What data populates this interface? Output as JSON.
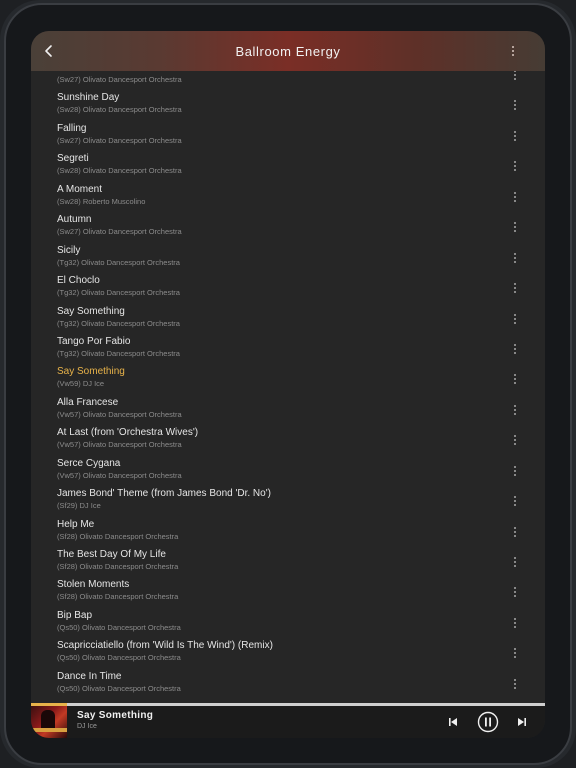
{
  "header": {
    "title": "Ballroom Energy"
  },
  "tracks": [
    {
      "title": "",
      "subtitle": "(Sw27) Olivato Dancesport Orchestra",
      "active": false
    },
    {
      "title": "Sunshine Day",
      "subtitle": "(Sw28) Olivato Dancesport Orchestra",
      "active": false
    },
    {
      "title": "Falling",
      "subtitle": "(Sw27) Olivato Dancesport Orchestra",
      "active": false
    },
    {
      "title": "Segreti",
      "subtitle": "(Sw28) Olivato Dancesport Orchestra",
      "active": false
    },
    {
      "title": "A Moment",
      "subtitle": "(Sw28) Roberto Muscolino",
      "active": false
    },
    {
      "title": "Autumn",
      "subtitle": "(Sw27) Olivato Dancesport Orchestra",
      "active": false
    },
    {
      "title": "Sicily",
      "subtitle": "(Tg32) Olivato Dancesport Orchestra",
      "active": false
    },
    {
      "title": "El Choclo",
      "subtitle": "(Tg32) Olivato Dancesport Orchestra",
      "active": false
    },
    {
      "title": "Say Something",
      "subtitle": "(Tg32) Olivato Dancesport Orchestra",
      "active": false
    },
    {
      "title": "Tango Por Fabio",
      "subtitle": "(Tg32) Olivato Dancesport Orchestra",
      "active": false
    },
    {
      "title": "Say Something",
      "subtitle": "(Vw59) DJ Ice",
      "active": true
    },
    {
      "title": "Alla Francese",
      "subtitle": "(Vw57) Olivato Dancesport Orchestra",
      "active": false
    },
    {
      "title": "At Last (from 'Orchestra Wives')",
      "subtitle": "(Vw57) Olivato Dancesport Orchestra",
      "active": false
    },
    {
      "title": "Serce Cygana",
      "subtitle": "(Vw57) Olivato Dancesport Orchestra",
      "active": false
    },
    {
      "title": "James Bond' Theme (from James Bond 'Dr. No')",
      "subtitle": "(Sf29) DJ Ice",
      "active": false
    },
    {
      "title": "Help Me",
      "subtitle": "(Sf28) Olivato Dancesport Orchestra",
      "active": false
    },
    {
      "title": "The Best Day Of My Life",
      "subtitle": "(Sf28) Olivato Dancesport Orchestra",
      "active": false
    },
    {
      "title": "Stolen Moments",
      "subtitle": "(Sf28) Olivato Dancesport Orchestra",
      "active": false
    },
    {
      "title": "Bip Bap",
      "subtitle": "(Qs50) Olivato Dancesport Orchestra",
      "active": false
    },
    {
      "title": "Scapricciatiello (from 'Wild Is The Wind') (Remix)",
      "subtitle": "(Qs50) Olivato Dancesport Orchestra",
      "active": false
    },
    {
      "title": "Dance In Time",
      "subtitle": "(Qs50) Olivato Dancesport Orchestra",
      "active": false
    }
  ],
  "player": {
    "title": "Say Something",
    "artist": "DJ Ice",
    "progress": 0.07,
    "state": "playing"
  },
  "colors": {
    "accent": "#e8b34a",
    "background": "#262626",
    "text": "#e6e6e6",
    "subtext": "#8c8c8c"
  },
  "icons": {
    "back": "chevron-left-icon",
    "menu": "more-vertical-icon",
    "prev": "skip-previous-icon",
    "pause": "pause-circle-icon",
    "next": "skip-next-icon"
  }
}
